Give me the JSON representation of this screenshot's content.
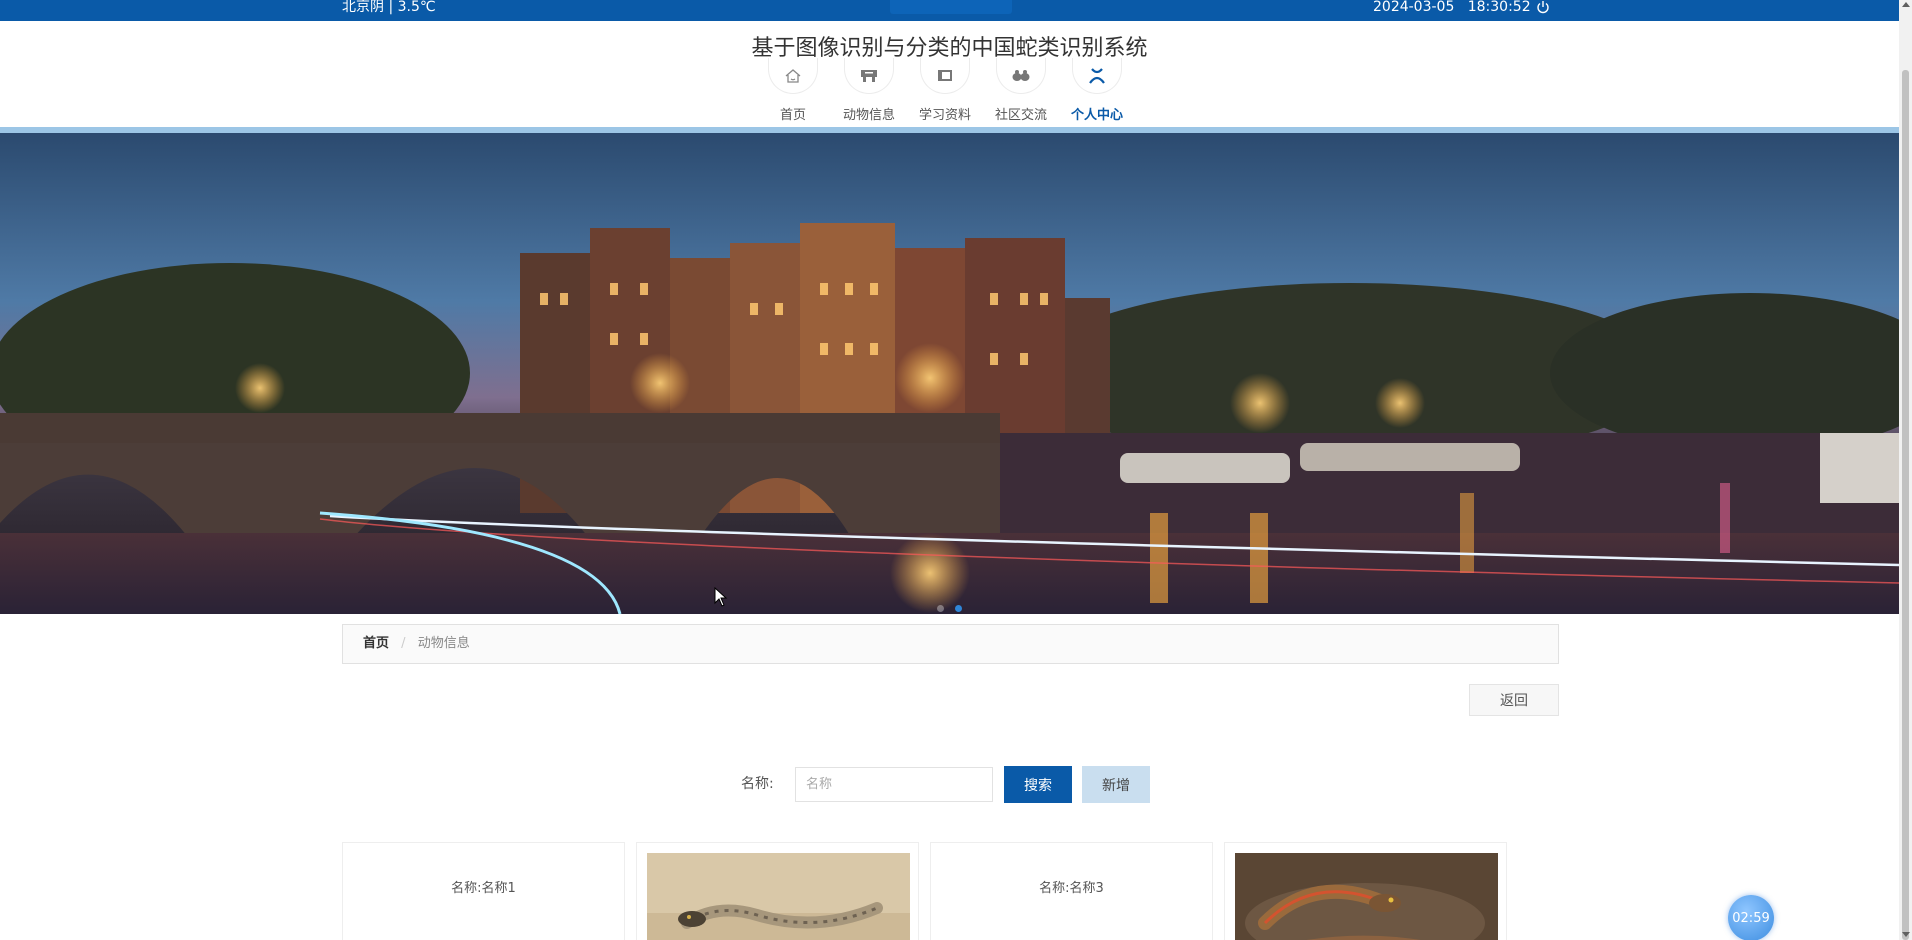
{
  "topbar": {
    "weather": "北京阴 | 3.5℃",
    "date": "2024-03-05",
    "time": "18:30:52",
    "power_icon": "power-icon"
  },
  "header": {
    "title": "基于图像识别与分类的中国蛇类识别系统"
  },
  "nav": {
    "items": [
      {
        "label": "首页",
        "icon": "home-icon"
      },
      {
        "label": "动物信息",
        "icon": "animal-info-icon"
      },
      {
        "label": "学习资料",
        "icon": "book-icon"
      },
      {
        "label": "社区交流",
        "icon": "community-icon"
      },
      {
        "label": "个人中心",
        "icon": "user-icon",
        "active": true
      }
    ]
  },
  "banner": {
    "slides": 2,
    "active_slide": 2
  },
  "breadcrumb": {
    "home": "首页",
    "separator": "/",
    "current": "动物信息"
  },
  "actions": {
    "back": "返回"
  },
  "search": {
    "label": "名称:",
    "placeholder": "名称",
    "value": "",
    "search_button": "搜索",
    "add_button": "新增"
  },
  "cards": [
    {
      "name_label": "名称:名称1",
      "has_image": false
    },
    {
      "name_label": "",
      "has_image": true,
      "image": "snake-photo-1"
    },
    {
      "name_label": "名称:名称3",
      "has_image": false
    },
    {
      "name_label": "",
      "has_image": true,
      "image": "snake-photo-2"
    }
  ],
  "timer": {
    "value": "02:59"
  },
  "colors": {
    "primary": "#0a5aa8",
    "accent_light": "#c9deef",
    "header_line": "#9cc6e6"
  }
}
